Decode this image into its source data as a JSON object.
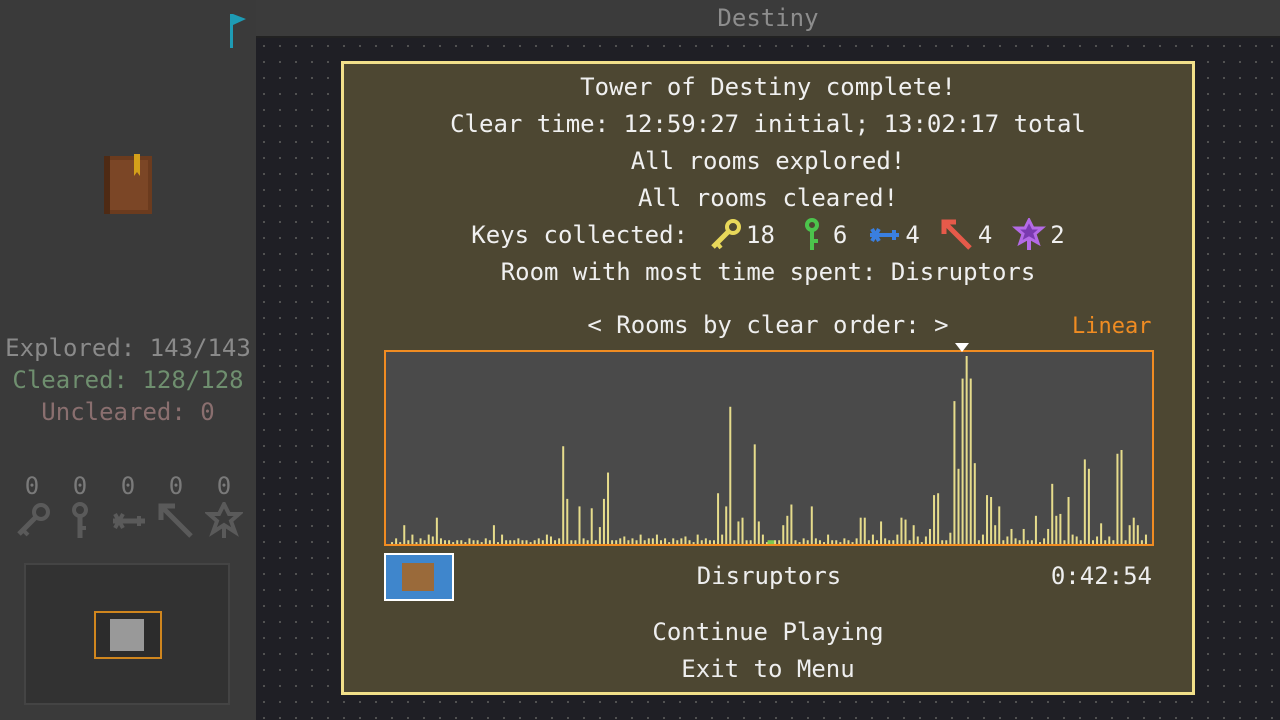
{
  "window": {
    "title": "Destiny"
  },
  "sidebar": {
    "explored": "Explored: 143/143",
    "cleared": "Cleared: 128/128",
    "uncleared": "Uncleared: 0",
    "key_counts": [
      "0",
      "0",
      "0",
      "0",
      "0"
    ],
    "key_icons": [
      "yellow-key-icon",
      "green-key-icon",
      "blue-key-icon",
      "red-key-icon",
      "purple-key-icon"
    ]
  },
  "dialog": {
    "heading": "Tower of Destiny complete!",
    "clear_time": "Clear time: 12:59:27 initial; 13:02:17 total",
    "explored": "All rooms explored!",
    "cleared": "All rooms cleared!",
    "keys_label": "Keys collected:",
    "keys": [
      {
        "icon": "yellow-key-icon",
        "count": "18",
        "color": "#e8d85a"
      },
      {
        "icon": "green-key-icon",
        "count": "6",
        "color": "#4cc44c"
      },
      {
        "icon": "blue-key-icon",
        "count": "4",
        "color": "#3a7fe0"
      },
      {
        "icon": "red-key-icon",
        "count": "4",
        "color": "#e65a4a"
      },
      {
        "icon": "purple-key-icon",
        "count": "2",
        "color": "#b46ae6"
      }
    ],
    "most_time": "Room with most time spent: Disruptors",
    "graph_title": "< Rooms by clear order: >",
    "scale": "Linear",
    "selected_room": "Disruptors",
    "selected_time": "0:42:54",
    "continue": "Continue Playing",
    "exit": "Exit to Menu"
  },
  "colors": {
    "accent": "#f08c22",
    "dialog_border": "#f2e08a",
    "bar": "#e6dc8c",
    "bar_selected": "#7ec850"
  },
  "chart_data": {
    "type": "bar",
    "title": "< Rooms by clear order: >",
    "scale": "linear",
    "selected_index": 93,
    "values": [
      1,
      3,
      1,
      10,
      2,
      5,
      1,
      3,
      2,
      5,
      4,
      14,
      3,
      2,
      2,
      1,
      2,
      2,
      1,
      3,
      2,
      2,
      1,
      3,
      2,
      10,
      1,
      5,
      2,
      2,
      2,
      3,
      2,
      2,
      1,
      2,
      3,
      2,
      5,
      4,
      2,
      3,
      52,
      24,
      2,
      2,
      20,
      3,
      2,
      19,
      2,
      9,
      24,
      38,
      2,
      2,
      3,
      4,
      2,
      3,
      2,
      5,
      2,
      3,
      3,
      5,
      2,
      3,
      1,
      3,
      2,
      3,
      4,
      2,
      1,
      5,
      2,
      3,
      2,
      2,
      27,
      5,
      20,
      73,
      2,
      12,
      14,
      2,
      2,
      53,
      12,
      5,
      1,
      2,
      2,
      2,
      10,
      15,
      21,
      2,
      1,
      3,
      2,
      20,
      3,
      2,
      1,
      5,
      2,
      2,
      1,
      3,
      2,
      1,
      3,
      14,
      14,
      2,
      5,
      2,
      12,
      3,
      2,
      2,
      5,
      14,
      13,
      2,
      10,
      4,
      1,
      4,
      8,
      26,
      27,
      2,
      2,
      6,
      76,
      40,
      88,
      100,
      88,
      43,
      2,
      5,
      26,
      25,
      10,
      20,
      2,
      4,
      8,
      3,
      2,
      8,
      2,
      2,
      15,
      1,
      3,
      8,
      32,
      15,
      16,
      2,
      25,
      5,
      4,
      2,
      45,
      40,
      2,
      4,
      11,
      2,
      4,
      2,
      48,
      50,
      2,
      10,
      14,
      10,
      2,
      5
    ],
    "ylim": [
      0,
      100
    ]
  }
}
